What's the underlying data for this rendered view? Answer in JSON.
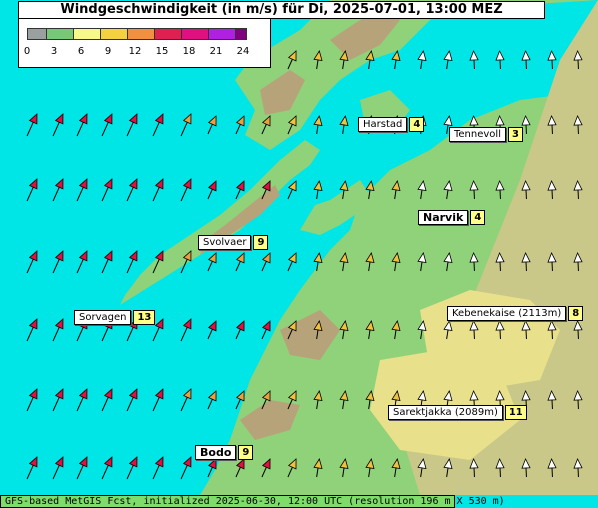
{
  "title": "Windgeschwindigkeit (in m/s) für Di, 2025-07-01, 13:00 MEZ",
  "legend": {
    "ticks": [
      "0",
      "3",
      "6",
      "9",
      "12",
      "15",
      "18",
      "21",
      "24"
    ],
    "colors": [
      "#9aa0a0",
      "#77c877",
      "#f7f78a",
      "#f5d040",
      "#f09040",
      "#e02050",
      "#e01080",
      "#b020e0",
      "#800080"
    ]
  },
  "places": [
    {
      "name": "Harstad",
      "value": "4",
      "bold": false
    },
    {
      "name": "Tennevoll",
      "value": "3",
      "bold": false
    },
    {
      "name": "Narvik",
      "value": "4",
      "bold": true
    },
    {
      "name": "Svolvaer",
      "value": "9",
      "bold": false
    },
    {
      "name": "Kebenekaise (2113m)",
      "value": "8",
      "bold": false
    },
    {
      "name": "Sorvagen",
      "value": "13",
      "bold": false
    },
    {
      "name": "Sarektjakka (2089m)",
      "value": "11",
      "bold": false
    },
    {
      "name": "Bodo",
      "value": "9",
      "bold": true
    }
  ],
  "footer": "GFS-based MetGIS Fcst, initialized 2025-06-30, 12:00 UTC  (resolution 196 m X 530 m)",
  "colors": {
    "sea": "#00e5e5",
    "land": "#8fd27a",
    "mountain": "#b7a37a",
    "highland": "#e8e08a"
  }
}
